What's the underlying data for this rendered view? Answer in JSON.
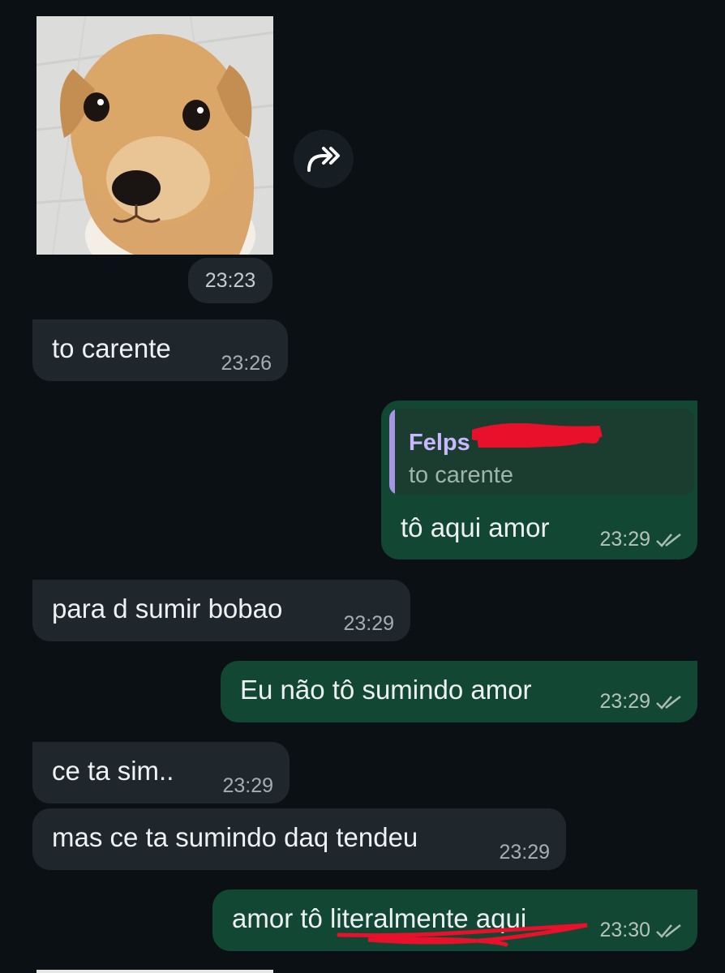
{
  "colors": {
    "background": "#0b1014",
    "incoming_bubble": "#1f272d",
    "outgoing_bubble": "#124733",
    "quote_bar": "#a894e4",
    "quote_name": "#c9b8ff",
    "redaction_red": "#e8102a"
  },
  "photo_message": {
    "icon": "puppy-photo",
    "forward_icon": "forward-icon",
    "time": "23:23"
  },
  "messages": [
    {
      "direction": "in",
      "text": "to carente",
      "time": "23:26"
    },
    {
      "direction": "out",
      "reply_to": {
        "name": "Felps",
        "text": "to carente"
      },
      "text": "tô aqui amor",
      "time": "23:29",
      "status_icon": "double-check-icon"
    },
    {
      "direction": "in",
      "text": "para d sumir bobao",
      "time": "23:29"
    },
    {
      "direction": "out",
      "text": "Eu não tô sumindo amor",
      "time": "23:29",
      "status_icon": "double-check-icon"
    },
    {
      "direction": "in",
      "text": "ce ta sim..",
      "time": "23:29"
    },
    {
      "direction": "in",
      "text": "mas ce ta sumindo daq tendeu",
      "time": "23:29"
    },
    {
      "direction": "out",
      "text": "amor tô literalmente aqui",
      "time": "23:30",
      "status_icon": "double-check-icon"
    }
  ]
}
